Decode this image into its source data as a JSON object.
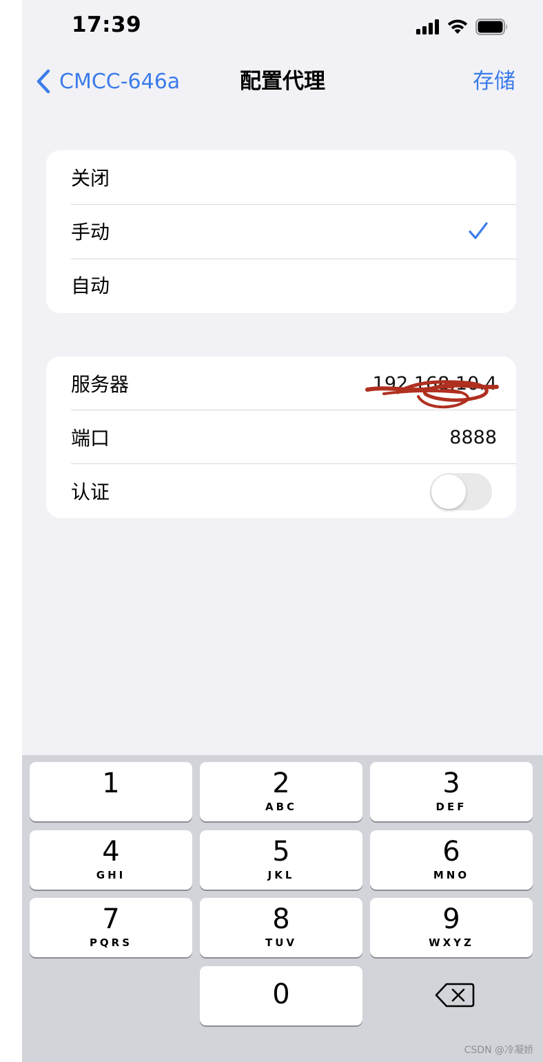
{
  "status_bar": {
    "time": "17:39"
  },
  "nav": {
    "back_label": "CMCC-646a",
    "title": "配置代理",
    "save_label": "存储"
  },
  "proxy_mode": {
    "options": [
      {
        "label": "关闭",
        "selected": false
      },
      {
        "label": "手动",
        "selected": true
      },
      {
        "label": "自动",
        "selected": false
      }
    ]
  },
  "settings": {
    "server_label": "服务器",
    "server_value": "192.168.10.4",
    "port_label": "端口",
    "port_value": "8888",
    "auth_label": "认证",
    "auth_enabled": false
  },
  "keypad": {
    "keys": [
      {
        "digit": "1",
        "letters": ""
      },
      {
        "digit": "2",
        "letters": "ABC"
      },
      {
        "digit": "3",
        "letters": "DEF"
      },
      {
        "digit": "4",
        "letters": "GHI"
      },
      {
        "digit": "5",
        "letters": "JKL"
      },
      {
        "digit": "6",
        "letters": "MNO"
      },
      {
        "digit": "7",
        "letters": "PQRS"
      },
      {
        "digit": "8",
        "letters": "TUV"
      },
      {
        "digit": "9",
        "letters": "WXYZ"
      },
      {
        "digit": "0",
        "letters": ""
      }
    ],
    "backspace_icon": "delete-left-icon"
  },
  "colors": {
    "accent": "#3b7cea",
    "background": "#f2f2f6",
    "keypad_bg": "#d2d4d9",
    "scribble": "#b03020"
  },
  "watermark": "CSDN @冷凝娇"
}
